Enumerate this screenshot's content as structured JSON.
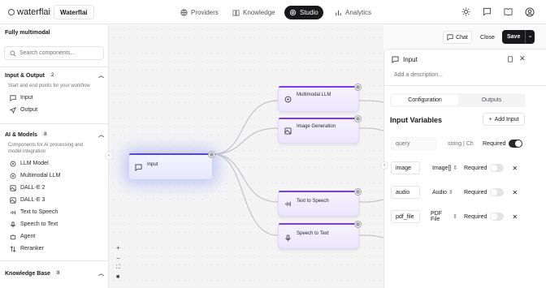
{
  "header": {
    "logo_text": "waterflai",
    "brand": "Waterflai",
    "tabs": [
      {
        "label": "Providers",
        "icon": "globe-icon"
      },
      {
        "label": "Knowledge",
        "icon": "book-icon"
      },
      {
        "label": "Studio",
        "icon": "gear-icon",
        "active": true
      },
      {
        "label": "Analytics",
        "icon": "bar-chart-icon"
      }
    ]
  },
  "sidebar": {
    "title": "Fully multimodal",
    "search_placeholder": "Search components...",
    "sections": [
      {
        "title": "Input & Output",
        "count": "2",
        "desc": "Start and end points for your workflow",
        "items": [
          "Input",
          "Output"
        ]
      },
      {
        "title": "AI & Models",
        "count": "8",
        "desc": "Components for AI processing and model integration",
        "items": [
          "LLM Model",
          "Multimodal LLM",
          "DALL-E 2",
          "DALL-E 3",
          "Text to Speech",
          "Speech to Text",
          "Agent",
          "Reranker"
        ]
      },
      {
        "title": "Knowledge Base",
        "count": "8"
      }
    ]
  },
  "toolbar": {
    "chat": "Chat",
    "close": "Close",
    "save": "Save"
  },
  "nodes": {
    "input": "Input",
    "multimodal": "Multimodal LLM",
    "image_gen": "Image Generation",
    "tts": "Text to Speech",
    "stt": "Speech to Text"
  },
  "panel": {
    "title": "Input",
    "description_placeholder": "Add a description...",
    "tab_config": "Configuration",
    "tab_outputs": "Outputs",
    "section_title": "Input Variables",
    "add_input": "Add Input",
    "rows": [
      {
        "name": "query",
        "type": "string | Ch",
        "required": "Required",
        "on": true
      },
      {
        "name": "image",
        "type": "Image[]",
        "required": "Required",
        "on": false
      },
      {
        "name": "audio",
        "type": "Audio",
        "required": "Required",
        "on": false
      },
      {
        "name": "pdf_file",
        "type": "PDF File",
        "required": "Required",
        "on": false
      }
    ]
  },
  "colors": {
    "accent": "#7c3aed",
    "dark": "#18181b"
  }
}
